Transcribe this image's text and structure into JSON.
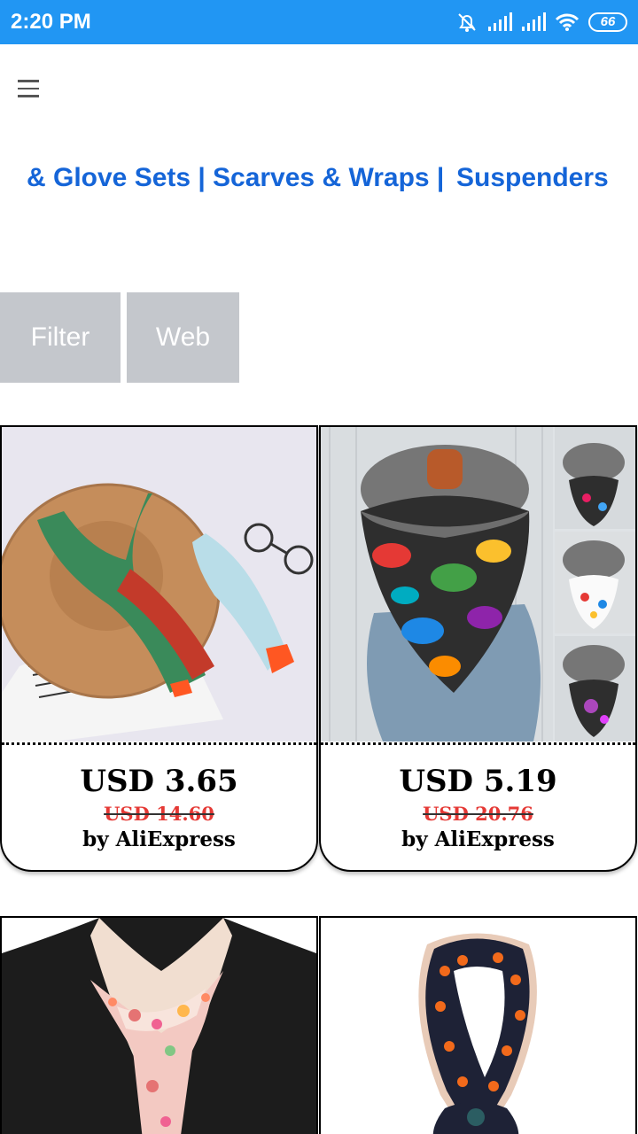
{
  "status_bar": {
    "time": "2:20 PM",
    "battery": "66"
  },
  "categories": [
    {
      "label": "& Glove Sets |"
    },
    {
      "label": "Scarves & Wraps |"
    },
    {
      "label": "Suspenders"
    }
  ],
  "buttons": {
    "filter": "Filter",
    "web": "Web"
  },
  "products": [
    {
      "price": "USD 3.65",
      "old_price": "USD 14.60",
      "seller": "by AliExpress"
    },
    {
      "price": "USD 5.19",
      "old_price": "USD 20.76",
      "seller": "by AliExpress"
    }
  ],
  "colors": {
    "status_bar": "#2196f3",
    "category_link": "#1565d8",
    "button_bg": "#c4c7cc",
    "old_price": "#e53935"
  }
}
